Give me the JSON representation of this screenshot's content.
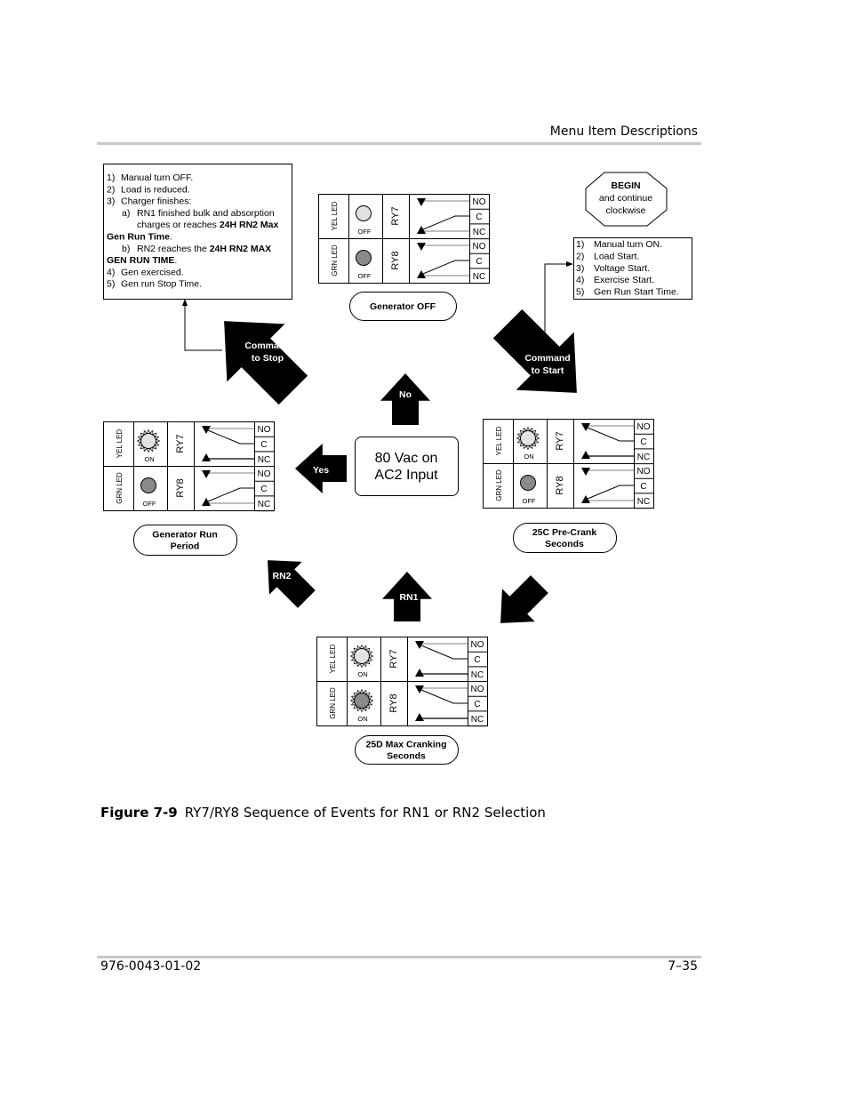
{
  "header": {
    "section_title": "Menu Item Descriptions"
  },
  "figure": {
    "number": "Figure 7-9",
    "caption": "RY7/RY8 Sequence of Events for RN1 or RN2 Selection",
    "begin_label": [
      "BEGIN",
      "and continue",
      "clockwise"
    ],
    "stop_conditions": [
      {
        "prefix": "1)",
        "text": "Manual turn OFF."
      },
      {
        "prefix": "2)",
        "text": "Load is reduced."
      },
      {
        "prefix": "3)",
        "text": "Charger finishes:"
      },
      {
        "prefix": "a)",
        "text": "RN1 finished bulk and absorption"
      },
      {
        "prefix": "",
        "text": "charges or reaches ",
        "bold": "24H RN2 Max"
      },
      {
        "prefix": "",
        "text": "",
        "bold": "Gen Run Time",
        "suffix": "."
      },
      {
        "prefix": "b)",
        "text": "RN2 reaches the ",
        "bold": "24H RN2 MAX"
      },
      {
        "prefix": "",
        "text": "",
        "bold": "GEN RUN TIME",
        "suffix": "."
      },
      {
        "prefix": "4)",
        "text": "Gen exercised."
      },
      {
        "prefix": "5)",
        "text": "Gen run Stop Time."
      }
    ],
    "start_conditions": [
      {
        "prefix": "1)",
        "text": "Manual turn ON."
      },
      {
        "prefix": "2)",
        "text": "Load Start."
      },
      {
        "prefix": "3)",
        "text": "Voltage Start."
      },
      {
        "prefix": "4)",
        "text": "Exercise Start."
      },
      {
        "prefix": "5)",
        "text": "Gen Run Start Time."
      }
    ],
    "decision": [
      "80 Vac on",
      "AC2 Input"
    ],
    "arrows": {
      "command_stop": [
        "Command",
        "to Stop"
      ],
      "command_start": [
        "Command",
        "to Start"
      ],
      "no": "No",
      "yes": "Yes",
      "rn1": "RN1",
      "rn2": "RN2"
    },
    "relay_labels": {
      "yel_led": "YEL LED",
      "grn_led": "GRN LED",
      "ry7": "RY7",
      "ry8": "RY8",
      "terminals": [
        "NO",
        "C",
        "NC"
      ]
    },
    "panels": [
      {
        "id": "generator-off",
        "title": [
          "Generator OFF"
        ],
        "yel": "OFF",
        "grn": "OFF"
      },
      {
        "id": "generator-run-period",
        "title": [
          "Generator Run",
          "Period"
        ],
        "yel": "ON",
        "grn": "OFF"
      },
      {
        "id": "pre-crank",
        "title": [
          "25C Pre-Crank",
          "Seconds"
        ],
        "yel": "ON",
        "grn": "OFF"
      },
      {
        "id": "max-cranking",
        "title": [
          "25D Max Cranking",
          "Seconds"
        ],
        "yel": "ON",
        "grn": "ON"
      }
    ]
  },
  "footer": {
    "doc_number": "976-0043-01-02",
    "page": "7–35"
  }
}
